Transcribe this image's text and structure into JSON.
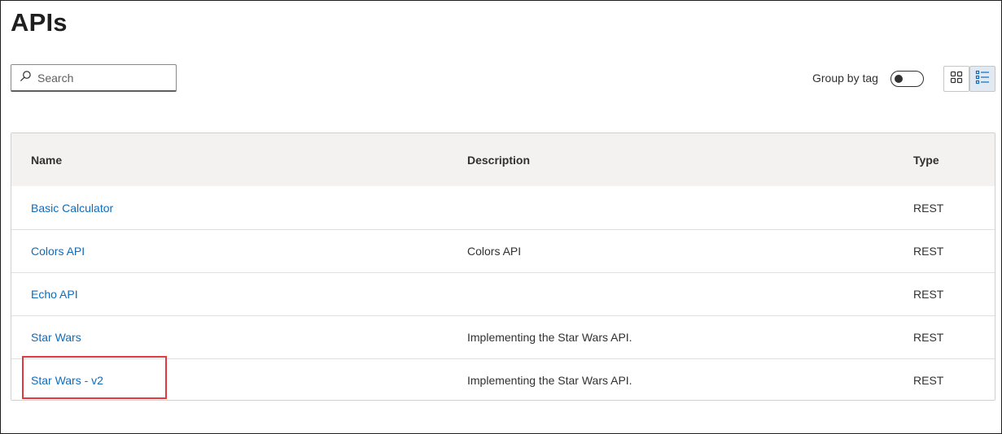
{
  "page": {
    "title": "APIs"
  },
  "search": {
    "placeholder": "Search",
    "value": ""
  },
  "toolbar": {
    "group_by_tag_label": "Group by tag",
    "group_by_tag_on": false,
    "view_modes": [
      {
        "name": "grid-view",
        "icon": "grid-icon",
        "selected": false
      },
      {
        "name": "list-view",
        "icon": "list-icon",
        "selected": true
      }
    ]
  },
  "table": {
    "columns": [
      "Name",
      "Description",
      "Type"
    ],
    "rows": [
      {
        "name": "Basic Calculator",
        "description": "",
        "type": "REST"
      },
      {
        "name": "Colors API",
        "description": "Colors API",
        "type": "REST"
      },
      {
        "name": "Echo API",
        "description": "",
        "type": "REST"
      },
      {
        "name": "Star Wars",
        "description": "Implementing the Star Wars API.",
        "type": "REST"
      },
      {
        "name": "Star Wars - v2",
        "description": "Implementing the Star Wars API.",
        "type": "REST"
      }
    ]
  },
  "colors": {
    "link": "#0f6cbd",
    "header_bg": "#f3f2f1",
    "highlight": "#e0393e",
    "selected_view_bg": "#e1e9f3"
  }
}
